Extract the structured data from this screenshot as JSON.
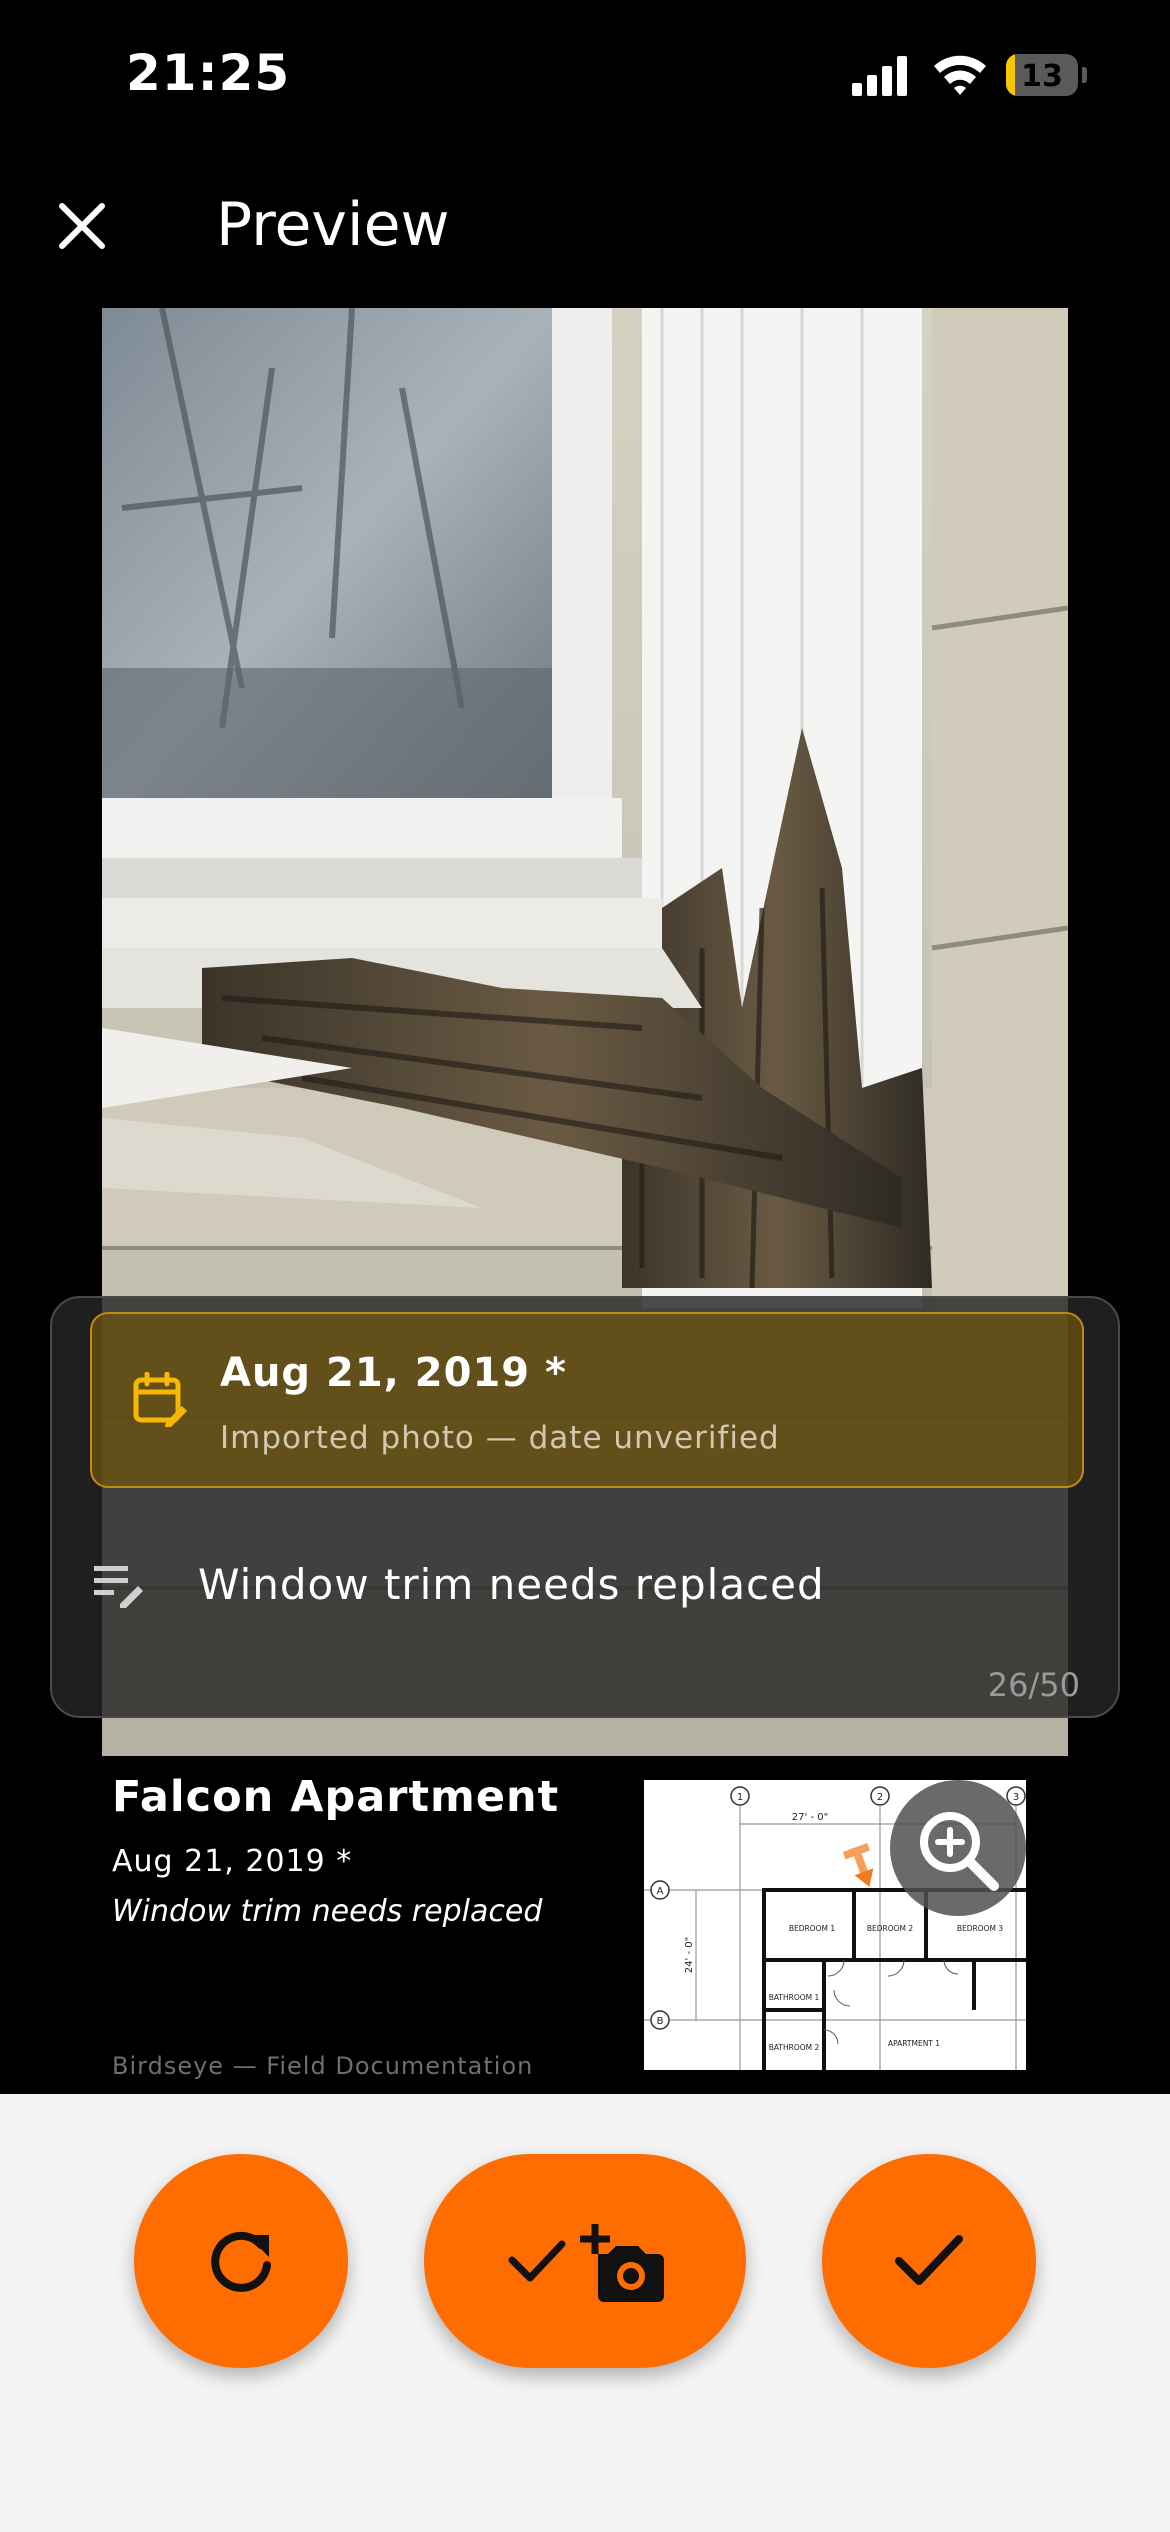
{
  "status_bar": {
    "time": "21:25",
    "battery_level": "13"
  },
  "header": {
    "title": "Preview",
    "close_icon": "close-icon"
  },
  "photo_card": {
    "date": "Aug 21, 2019 *",
    "date_note": "Imported photo — date unverified",
    "date_icon": "calendar-edit-icon",
    "description": "Window trim needs replaced",
    "notes_icon": "notes-edit-icon",
    "char_count": "26/50"
  },
  "info": {
    "project_name": "Falcon Apartment",
    "date": "Aug 21, 2019 *",
    "description": "Window trim needs replaced",
    "credit": "Birdseye — Field Documentation"
  },
  "floorplan": {
    "rooms": [
      "BEDROOM 1",
      "BEDROOM 2",
      "BEDROOM 3",
      "BATHROOM 1",
      "BATHROOM 2",
      "APARTMENT 1"
    ],
    "dimensions": [
      "27' - 0\"",
      "24' - 0\""
    ],
    "grid_numbers": [
      "1",
      "2",
      "3"
    ],
    "grid_letters": [
      "A",
      "B"
    ],
    "zoom_icon": "zoom-in-icon"
  },
  "actions": {
    "retake_icon": "refresh-icon",
    "save_and_new_icon": "check-add-camera-icon",
    "save_icon": "check-icon"
  },
  "colors": {
    "accent": "#ff6d00",
    "date_highlight": "#c08a14",
    "panel_bg": "#f4f4f4"
  }
}
